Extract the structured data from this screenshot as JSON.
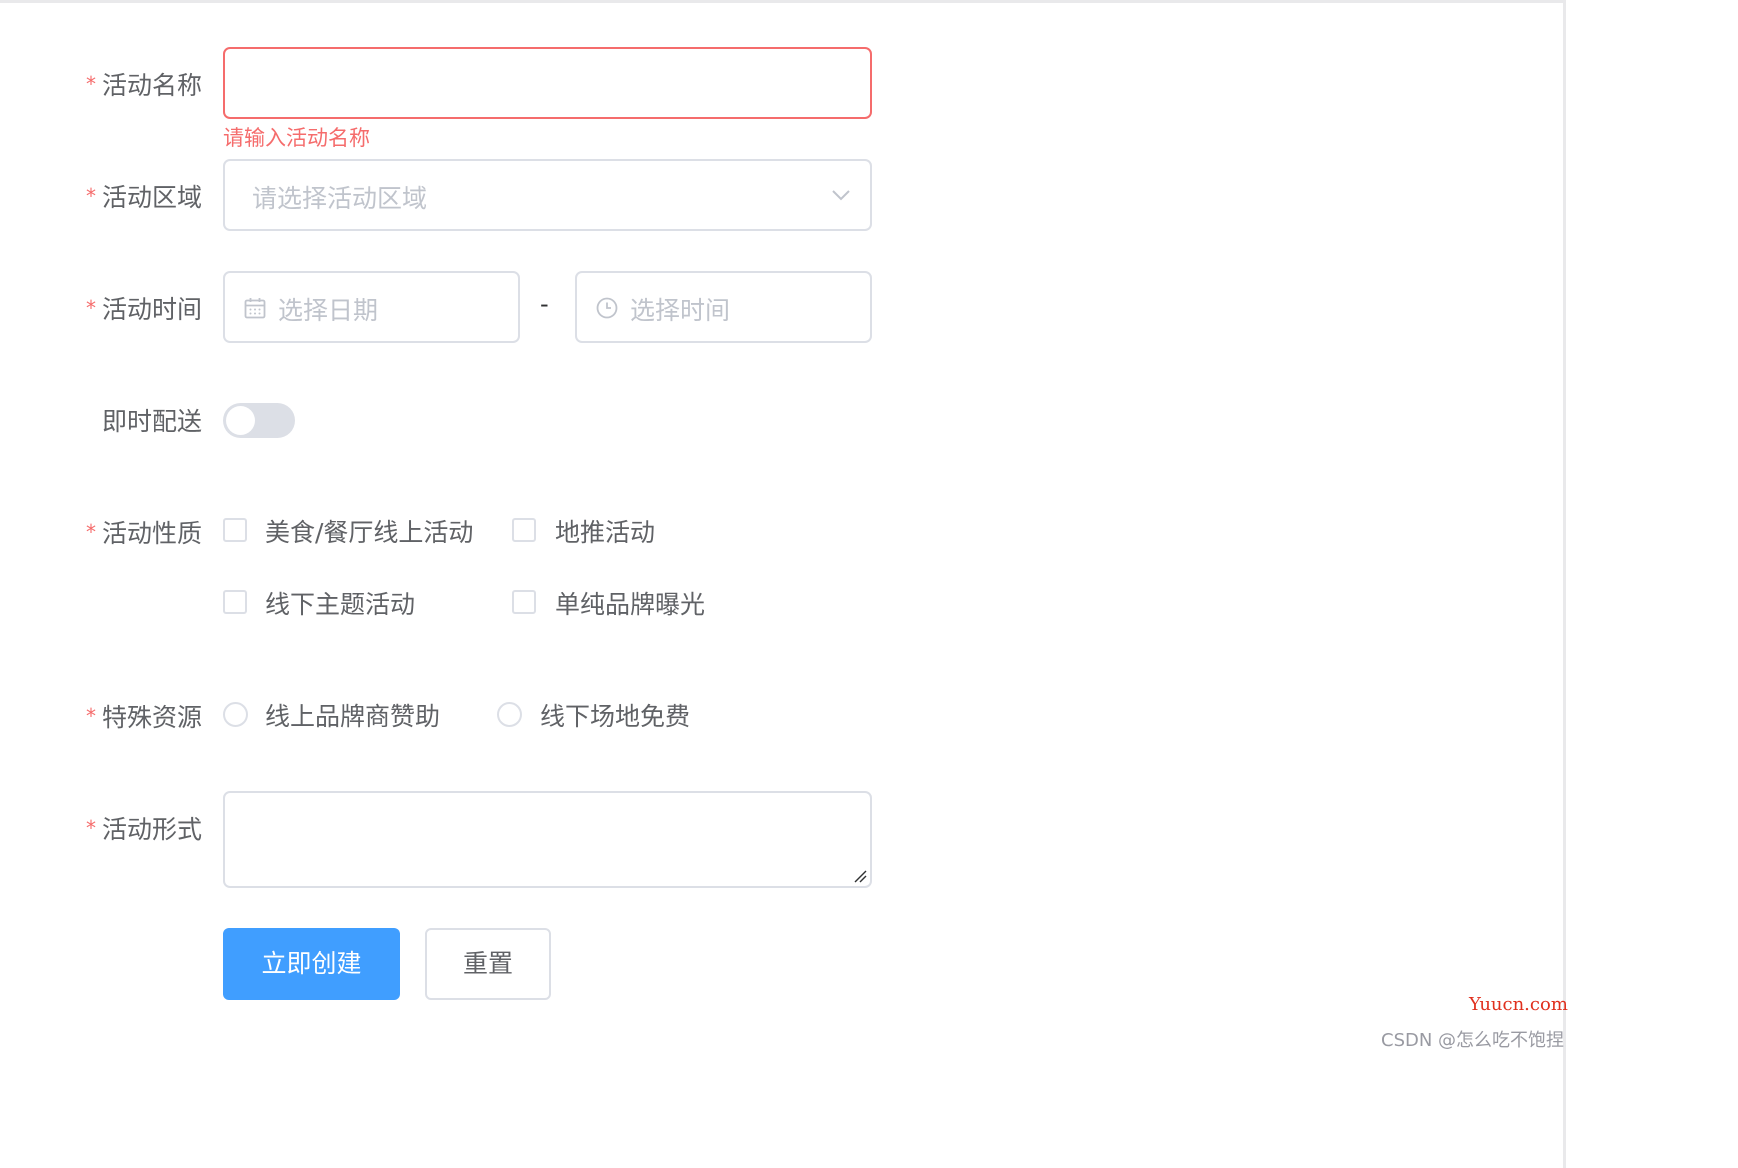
{
  "form": {
    "name": {
      "label": "活动名称",
      "value": "",
      "error": "请输入活动名称"
    },
    "region": {
      "label": "活动区域",
      "placeholder": "请选择活动区域"
    },
    "time": {
      "label": "活动时间",
      "date_placeholder": "选择日期",
      "time_placeholder": "选择时间",
      "separator": "-"
    },
    "delivery": {
      "label": "即时配送",
      "enabled": false
    },
    "type": {
      "label": "活动性质",
      "options": [
        "美食/餐厅线上活动",
        "地推活动",
        "线下主题活动",
        "单纯品牌曝光"
      ]
    },
    "resource": {
      "label": "特殊资源",
      "options": [
        "线上品牌商赞助",
        "线下场地免费"
      ]
    },
    "desc": {
      "label": "活动形式",
      "value": ""
    },
    "required_mark": "*"
  },
  "buttons": {
    "create": "立即创建",
    "reset": "重置"
  },
  "watermark": {
    "site": "Yuucn.com",
    "author": "CSDN @怎么吃不饱捏"
  },
  "colors": {
    "primary": "#409eff",
    "danger": "#f56c6c",
    "border": "#dcdfe6",
    "placeholder": "#c0c4cc",
    "text": "#606266"
  }
}
